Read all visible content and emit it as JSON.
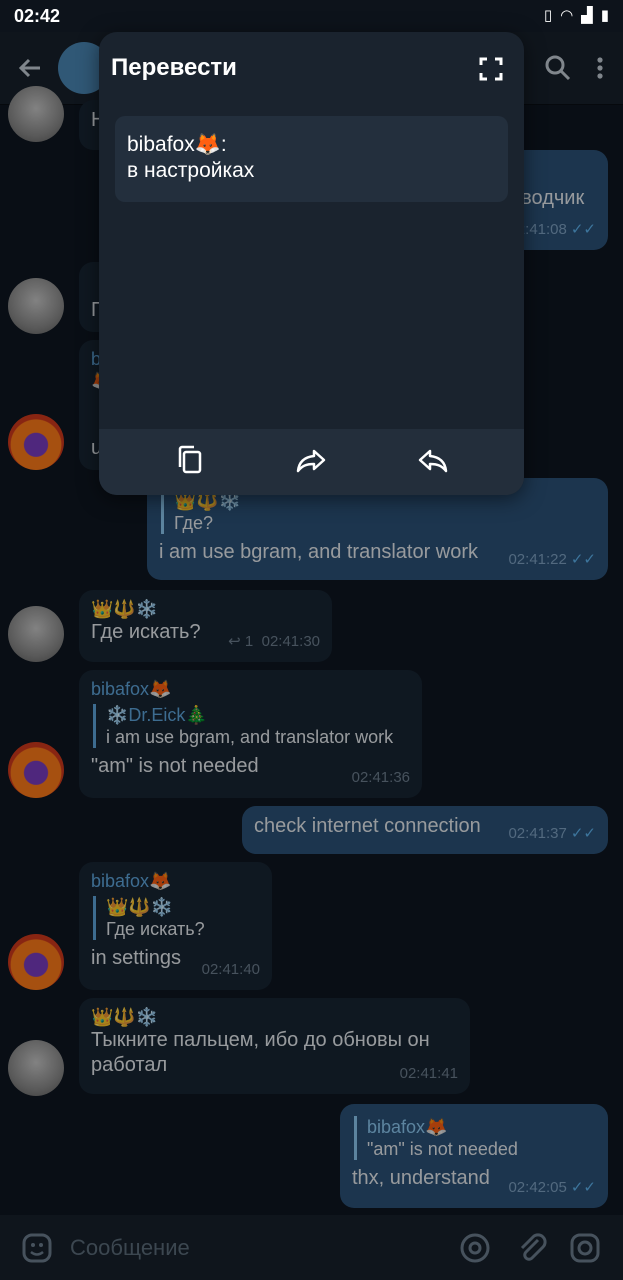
{
  "status": {
    "time": "02:42"
  },
  "popup": {
    "title": "Перевести",
    "sender": "bibafox🦊:",
    "text": "в настройках"
  },
  "messages": {
    "m1": {
      "text_partial": "Н"
    },
    "m2": {
      "text_partial": "еводчик",
      "time": "02:41:08"
    },
    "m3": {
      "text_partial": "П"
    },
    "m4": {
      "name": "bibafox🦊",
      "text_partial": "u"
    },
    "m5": {
      "reply_name": "👑🔱❄️",
      "reply_text": "Где?",
      "text": "i am use bgram, and translator work",
      "time": "02:41:22"
    },
    "m6": {
      "name": "👑🔱❄️",
      "text": "Где искать?",
      "replies": "1",
      "time": "02:41:30"
    },
    "m7": {
      "name": "bibafox🦊",
      "reply_name": "❄️Dr.Eick🎄",
      "reply_text": "i am use bgram, and translator work",
      "text": "\"am\" is not needed",
      "time": "02:41:36"
    },
    "m8": {
      "text": "check internet connection",
      "time": "02:41:37"
    },
    "m9": {
      "name": "bibafox🦊",
      "reply_name": "👑🔱❄️",
      "reply_text": "Где искать?",
      "text": "in settings",
      "time": "02:41:40"
    },
    "m10": {
      "name": "👑🔱❄️",
      "text": "Тыкните пальцем, ибо до обновы он работал",
      "time": "02:41:41"
    },
    "m11": {
      "reply_name": "bibafox🦊",
      "reply_text": "\"am\" is not needed",
      "text": "thx, understand",
      "time": "02:42:05"
    }
  },
  "composer": {
    "placeholder": "Сообщение"
  },
  "colors": {
    "background": "#0e1621",
    "incoming": "#182533",
    "outgoing": "#2b5278",
    "accent": "#5fa7de"
  }
}
